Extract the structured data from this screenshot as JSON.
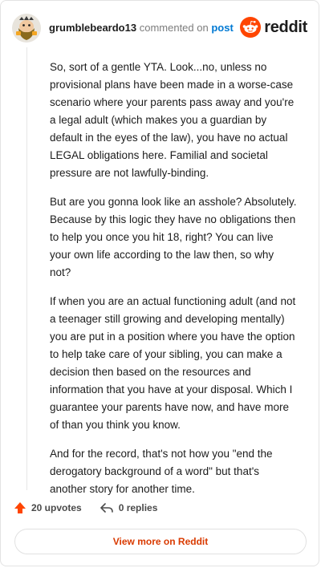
{
  "header": {
    "username": "grumblebeardo13",
    "commented_on": "commented on",
    "post_link": "post",
    "brand": "reddit"
  },
  "avatar": {
    "icon": "bearded-face-avatar"
  },
  "comment": {
    "paragraphs": [
      "So, sort of a gentle YTA. Look...no, unless no provisional plans have been made in a worse-case scenario where your parents pass away and you're a legal adult (which makes you a guardian by default in the eyes of the law), you have no actual LEGAL obligations here. Familial and societal pressure are not lawfully-binding.",
      "But are you gonna look like an asshole? Absolutely. Because by this logic they have no obligations then to help you once you hit 18, right? You can live your own life according to the law then, so why not?",
      "If when you are an actual functioning adult (and not a teenager still growing and developing mentally) you are put in a position where you have the option to help take care of your sibling, you can make a decision then based on the resources and information that you have at your disposal. Which I guarantee your parents have now, and have more of than you think you know.",
      "And for the record, that's not how you \"end the derogatory background of a word\" but that's another story for another time."
    ]
  },
  "actions": {
    "upvotes": "20 upvotes",
    "replies": "0 replies"
  },
  "footer": {
    "view_more": "View more on Reddit"
  },
  "colors": {
    "upvote_orange": "#ff4500",
    "link_blue": "#0079d3",
    "view_more_red": "#d93a00"
  }
}
